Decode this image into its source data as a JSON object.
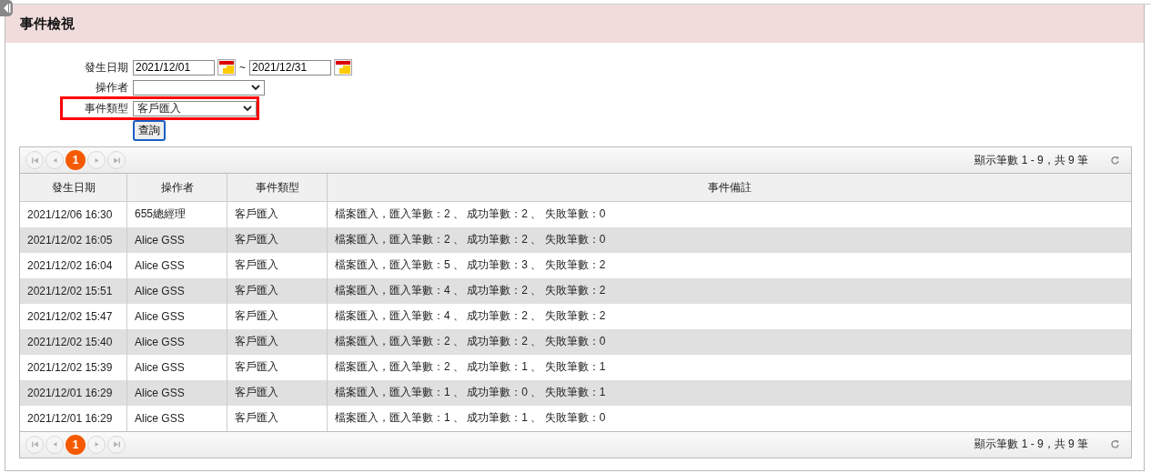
{
  "panel": {
    "title": "事件檢視"
  },
  "filters": [
    {
      "kind": "daterange",
      "label": "發生日期",
      "from": "2021/12/01",
      "separator": "~",
      "to": "2021/12/31",
      "highlighted": false
    },
    {
      "kind": "select",
      "label": "操作者",
      "highlighted": false
    },
    {
      "kind": "select",
      "label": "事件類型",
      "value": "客戶匯入",
      "highlighted": true
    }
  ],
  "query_button": "查詢",
  "pagers": [
    {
      "first_disabled": true,
      "prev_disabled": true,
      "next_disabled": true,
      "last_disabled": true,
      "pages": [
        {
          "label": "1",
          "selected": true
        }
      ],
      "summary": "顯示筆數 1 - 9，共 9 筆"
    },
    {
      "first_disabled": true,
      "prev_disabled": true,
      "next_disabled": true,
      "last_disabled": true,
      "pages": [
        {
          "label": "1",
          "selected": true
        }
      ],
      "summary": "顯示筆數 1 - 9，共 9 筆"
    }
  ],
  "table": {
    "columns": [
      "發生日期",
      "操作者",
      "事件類型",
      "事件備註"
    ],
    "rows": [
      [
        "2021/12/06 16:30",
        "655總經理",
        "客戶匯入",
        "檔案匯入，匯入筆數：2 、 成功筆數：2 、 失敗筆數：0"
      ],
      [
        "2021/12/02 16:05",
        "Alice GSS",
        "客戶匯入",
        "檔案匯入，匯入筆數：2 、 成功筆數：2 、 失敗筆數：0"
      ],
      [
        "2021/12/02 16:04",
        "Alice GSS",
        "客戶匯入",
        "檔案匯入，匯入筆數：5 、 成功筆數：3 、 失敗筆數：2"
      ],
      [
        "2021/12/02 15:51",
        "Alice GSS",
        "客戶匯入",
        "檔案匯入，匯入筆數：4 、 成功筆數：2 、 失敗筆數：2"
      ],
      [
        "2021/12/02 15:47",
        "Alice GSS",
        "客戶匯入",
        "檔案匯入，匯入筆數：4 、 成功筆數：2 、 失敗筆數：2"
      ],
      [
        "2021/12/02 15:40",
        "Alice GSS",
        "客戶匯入",
        "檔案匯入，匯入筆數：2 、 成功筆數：2 、 失敗筆數：0"
      ],
      [
        "2021/12/02 15:39",
        "Alice GSS",
        "客戶匯入",
        "檔案匯入，匯入筆數：2 、 成功筆數：1 、 失敗筆數：1"
      ],
      [
        "2021/12/01 16:29",
        "Alice GSS",
        "客戶匯入",
        "檔案匯入，匯入筆數：1 、 成功筆數：0 、 失敗筆數：1"
      ],
      [
        "2021/12/01 16:29",
        "Alice GSS",
        "客戶匯入",
        "檔案匯入，匯入筆數：1 、 成功筆數：1 、 失敗筆數：0"
      ]
    ]
  }
}
